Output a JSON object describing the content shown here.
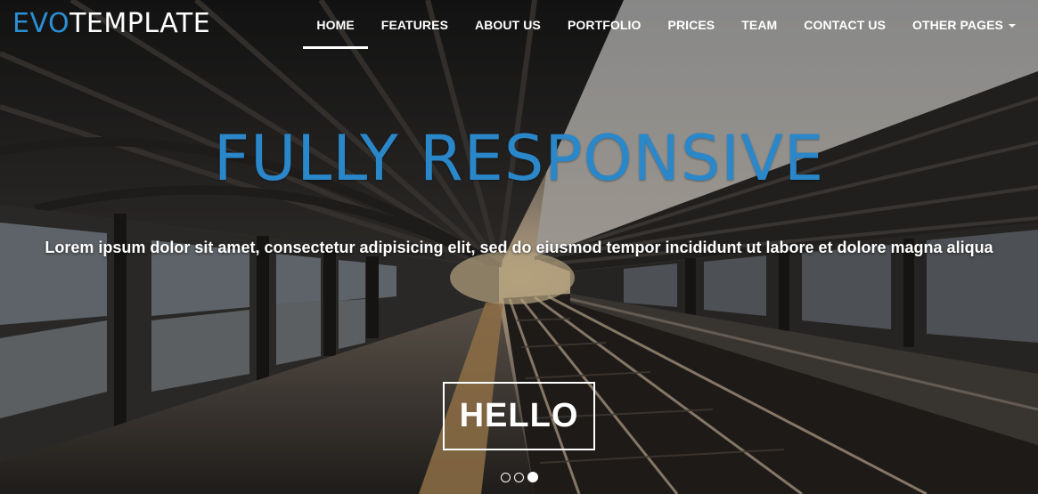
{
  "brand": {
    "accent": "EVO",
    "rest": "TEMPLATE"
  },
  "nav": {
    "items": [
      {
        "label": "HOME",
        "active": true
      },
      {
        "label": "FEATURES"
      },
      {
        "label": "ABOUT US"
      },
      {
        "label": "PORTFOLIO"
      },
      {
        "label": "PRICES"
      },
      {
        "label": "TEAM"
      },
      {
        "label": "CONTACT US"
      },
      {
        "label": "OTHER PAGES",
        "dropdown": true
      }
    ]
  },
  "hero": {
    "title": "FULLY RESPONSIVE",
    "text": "Lorem ipsum dolor sit amet, consectetur adipisicing elit, sed do eiusmod tempor incididunt ut labore et dolore magna aliqua",
    "button_label": "HELLO"
  },
  "carousel": {
    "slides": 3,
    "active_index": 2
  },
  "colors": {
    "accent": "#2a87c9",
    "brand_accent": "#2a8fd4",
    "text": "#ffffff"
  },
  "icons": {
    "dropdown": "caret-down-icon"
  }
}
